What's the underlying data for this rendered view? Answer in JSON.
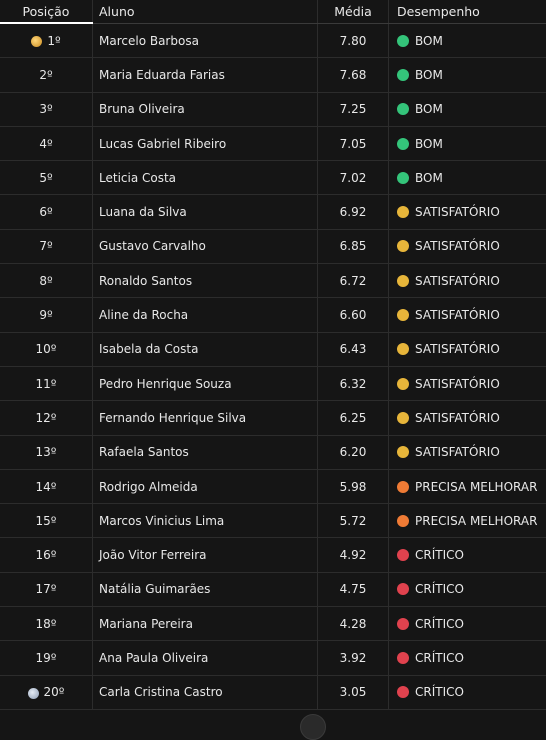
{
  "headers": {
    "position": "Posição",
    "student": "Aluno",
    "average": "Média",
    "performance": "Desempenho"
  },
  "status_colors": {
    "BOM": "#34c47a",
    "SATISFATÓRIO": "#e7b53a",
    "PRECISA MELHORAR": "#ef7b35",
    "CRÍTICO": "#e0424e"
  },
  "rows": [
    {
      "pos": "1º",
      "name": "Marcelo Barbosa",
      "avg": "7.80",
      "status": "BOM",
      "medal": "gold"
    },
    {
      "pos": "2º",
      "name": "Maria Eduarda Farias",
      "avg": "7.68",
      "status": "BOM"
    },
    {
      "pos": "3º",
      "name": "Bruna Oliveira",
      "avg": "7.25",
      "status": "BOM"
    },
    {
      "pos": "4º",
      "name": "Lucas Gabriel Ribeiro",
      "avg": "7.05",
      "status": "BOM"
    },
    {
      "pos": "5º",
      "name": "Leticia Costa",
      "avg": "7.02",
      "status": "BOM"
    },
    {
      "pos": "6º",
      "name": "Luana da Silva",
      "avg": "6.92",
      "status": "SATISFATÓRIO"
    },
    {
      "pos": "7º",
      "name": "Gustavo Carvalho",
      "avg": "6.85",
      "status": "SATISFATÓRIO"
    },
    {
      "pos": "8º",
      "name": "Ronaldo Santos",
      "avg": "6.72",
      "status": "SATISFATÓRIO"
    },
    {
      "pos": "9º",
      "name": "Aline da Rocha",
      "avg": "6.60",
      "status": "SATISFATÓRIO"
    },
    {
      "pos": "10º",
      "name": "Isabela da Costa",
      "avg": "6.43",
      "status": "SATISFATÓRIO"
    },
    {
      "pos": "11º",
      "name": "Pedro Henrique Souza",
      "avg": "6.32",
      "status": "SATISFATÓRIO"
    },
    {
      "pos": "12º",
      "name": "Fernando Henrique Silva",
      "avg": "6.25",
      "status": "SATISFATÓRIO"
    },
    {
      "pos": "13º",
      "name": "Rafaela Santos",
      "avg": "6.20",
      "status": "SATISFATÓRIO"
    },
    {
      "pos": "14º",
      "name": "Rodrigo Almeida",
      "avg": "5.98",
      "status": "PRECISA MELHORAR"
    },
    {
      "pos": "15º",
      "name": "Marcos Vinicius Lima",
      "avg": "5.72",
      "status": "PRECISA MELHORAR"
    },
    {
      "pos": "16º",
      "name": "João Vitor Ferreira",
      "avg": "4.92",
      "status": "CRÍTICO"
    },
    {
      "pos": "17º",
      "name": "Natália Guimarães",
      "avg": "4.75",
      "status": "CRÍTICO"
    },
    {
      "pos": "18º",
      "name": "Mariana Pereira",
      "avg": "4.28",
      "status": "CRÍTICO"
    },
    {
      "pos": "19º",
      "name": "Ana Paula Oliveira",
      "avg": "3.92",
      "status": "CRÍTICO"
    },
    {
      "pos": "20º",
      "name": "Carla Cristina Castro",
      "avg": "3.05",
      "status": "CRÍTICO",
      "medal": "silver"
    }
  ]
}
